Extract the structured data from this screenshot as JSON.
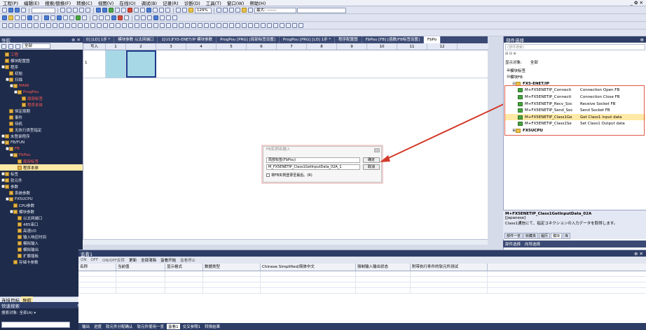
{
  "menu": [
    "工程(P)",
    "编辑(E)",
    "搜索/替换(F)",
    "转换(C)",
    "视图(V)",
    "在线(O)",
    "调试(B)",
    "记录(R)",
    "诊断(D)",
    "工具(T)",
    "窗口(W)",
    "帮助(H)"
  ],
  "toolbar": {
    "zoom": "129%",
    "max_label": "最大: -------",
    "window_controls": "_ ✿ ✕"
  },
  "nav": {
    "title": "导航",
    "filter": "全部",
    "items": [
      {
        "label": "工程",
        "level": 0,
        "toggle": "",
        "red": true
      },
      {
        "label": "模块配置图",
        "level": 0,
        "toggle": "",
        "red": false
      },
      {
        "label": "程序",
        "level": 0,
        "toggle": "■",
        "red": false
      },
      {
        "label": "初始",
        "level": 1,
        "toggle": "",
        "red": false
      },
      {
        "label": "扫描",
        "level": 1,
        "toggle": "■",
        "red": false
      },
      {
        "label": "MAIN",
        "level": 2,
        "toggle": "■",
        "red": true
      },
      {
        "label": "ProgPou",
        "level": 3,
        "toggle": "■",
        "red": true
      },
      {
        "label": "局部标签",
        "level": 4,
        "toggle": "",
        "red": true
      },
      {
        "label": "程序本体",
        "level": 4,
        "toggle": "",
        "red": true
      },
      {
        "label": "恒定周期",
        "level": 1,
        "toggle": "",
        "red": false
      },
      {
        "label": "事件",
        "level": 1,
        "toggle": "",
        "red": false
      },
      {
        "label": "待机",
        "level": 1,
        "toggle": "",
        "red": false
      },
      {
        "label": "无执行类型指定",
        "level": 1,
        "toggle": "",
        "red": false
      },
      {
        "label": "未登录程序",
        "level": 0,
        "toggle": "■",
        "red": false
      },
      {
        "label": "FB/FUN",
        "level": 0,
        "toggle": "■",
        "red": false
      },
      {
        "label": "FB",
        "level": 1,
        "toggle": "■",
        "red": true
      },
      {
        "label": "FbPou",
        "level": 2,
        "toggle": "■",
        "red": true
      },
      {
        "label": "局部标签",
        "level": 3,
        "toggle": "",
        "red": true
      },
      {
        "label": "程序本体",
        "level": 3,
        "toggle": "",
        "red": false,
        "selected": true
      },
      {
        "label": "标签",
        "level": 0,
        "toggle": "■",
        "red": false
      },
      {
        "label": "软元件",
        "level": 0,
        "toggle": "■",
        "red": false
      },
      {
        "label": "参数",
        "level": 0,
        "toggle": "■",
        "red": false
      },
      {
        "label": "系统参数",
        "level": 1,
        "toggle": "",
        "red": false
      },
      {
        "label": "FX5UCPU",
        "level": 1,
        "toggle": "■",
        "red": false
      },
      {
        "label": "CPU参数",
        "level": 2,
        "toggle": "",
        "red": false
      },
      {
        "label": "模块参数",
        "level": 2,
        "toggle": "■",
        "red": false
      },
      {
        "label": "以太网端口",
        "level": 3,
        "toggle": "",
        "red": false
      },
      {
        "label": "485串口",
        "level": 3,
        "toggle": "",
        "red": false
      },
      {
        "label": "高速I/O",
        "level": 3,
        "toggle": "",
        "red": false
      },
      {
        "label": "输入响应时间",
        "level": 3,
        "toggle": "",
        "red": false
      },
      {
        "label": "模拟输入",
        "level": 3,
        "toggle": "",
        "red": false
      },
      {
        "label": "模拟输出",
        "level": 3,
        "toggle": "",
        "red": false
      },
      {
        "label": "扩展插板",
        "level": 3,
        "toggle": "",
        "red": false
      },
      {
        "label": "存储卡参数",
        "level": 2,
        "toggle": "",
        "red": false
      }
    ],
    "tabs": [
      "连接目标",
      "导航"
    ]
  },
  "quick": {
    "title": "快速搜索",
    "label": "搜索对象: 全部(A) ▾"
  },
  "editor": {
    "tabs": [
      "0] [LD] 1步 *",
      "模块参数 以太网端口",
      "1[U1]FX5-ENET/IP 模块参数",
      "ProgPou [PRG] [局部标签设置]",
      "ProgPou [PRG] [LD] 1步 *",
      "程序配置图",
      "FbPou [FB] [函数/FB标签设置]",
      "FbPo"
    ],
    "row_header": "写入",
    "columns": [
      "1",
      "2",
      "3",
      "4",
      "5",
      "6",
      "7",
      "8",
      "9",
      "10",
      "11",
      "12"
    ],
    "row_label": "1"
  },
  "dialog": {
    "title": "FB实例名输入",
    "scope": "局部标签(FbPou)",
    "instance_name": "M_FX5ENETIP_Class1GetInputData_02A_1",
    "ok": "确定",
    "cancel": "取消",
    "checkbox": "将FB实例登录至最后。(R)"
  },
  "parts": {
    "title": "部件选择",
    "search_placeholder": "(部件搜索)",
    "target_label": "显示对象:",
    "target_value": "全部",
    "tree": [
      {
        "label": "模块标签",
        "toggle": "⊞",
        "icon": "",
        "indent": 0
      },
      {
        "label": "模块FB",
        "toggle": "⊟",
        "icon": "",
        "indent": 0
      },
      {
        "label": "FX5-ENET/IP",
        "toggle": "⊟",
        "icon": "folder",
        "indent": 1,
        "bold": true
      },
      {
        "label": "M+FX5ENETIP_Connecti",
        "desc": "Connection Open FB",
        "icon": "fb",
        "indent": 2
      },
      {
        "label": "M+FX5ENETIP_Connecti",
        "desc": "Connection Close FB",
        "icon": "fb",
        "indent": 2
      },
      {
        "label": "M+FX5ENETIP_Recv_Soc",
        "desc": "Receive Socket FB",
        "icon": "fb",
        "indent": 2
      },
      {
        "label": "M+FX5ENETIP_Send_Soc",
        "desc": "Send Socket FB",
        "icon": "fb",
        "indent": 2
      },
      {
        "label": "M+FX5ENETIP_Class1Ge",
        "desc": "Get Class1 input data",
        "icon": "fb",
        "indent": 2,
        "highlight": true
      },
      {
        "label": "M+FX5ENETIP_Class1Se",
        "desc": "Set Class1 Output data",
        "icon": "fb",
        "indent": 2
      },
      {
        "label": "FX5UCPU",
        "toggle": "⊞",
        "icon": "folder",
        "indent": 1,
        "bold": true
      }
    ],
    "desc_title": "M+FX5ENETIP_Class1GetInputData_02A",
    "desc_lang": "[Japanese]",
    "desc_text": "Class1通信にて、指定コネクションの入力データを取得します。",
    "tabs": [
      "部件一览",
      "收藏夹",
      "履历",
      "模块",
      "库"
    ],
    "footer": [
      "部件选择",
      "向导选择"
    ]
  },
  "monitor": {
    "title": "监看1",
    "tools": [
      "ON",
      "OFF",
      "ON/OFF反转",
      "更新",
      "全部清除",
      "监看开始",
      "监看停止"
    ],
    "columns": [
      "名称",
      "当前值",
      "显示格式",
      "数据类型",
      "Chinese Simplified/简体中文",
      "强制输入输出状态",
      "附带执行条件的软元件测试"
    ]
  },
  "bottom": [
    "输出",
    "进度",
    "软元件分配确认",
    "软元件使用一览",
    "监看1",
    "交叉参照1",
    "转换结果"
  ]
}
